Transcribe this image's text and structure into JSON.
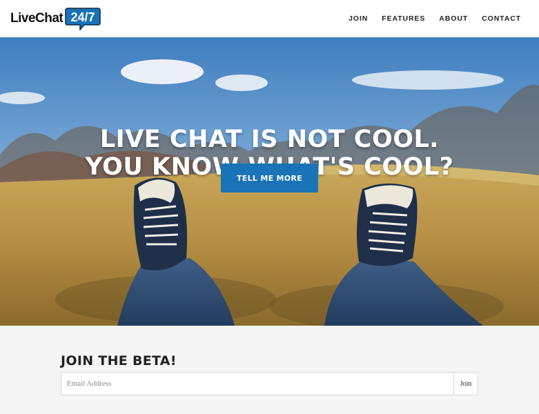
{
  "header": {
    "logo_text": "LiveChat",
    "logo_badge": "24/7",
    "nav": [
      {
        "label": "JOIN"
      },
      {
        "label": "FEATURES"
      },
      {
        "label": "ABOUT"
      },
      {
        "label": "CONTACT"
      }
    ]
  },
  "hero": {
    "line1": "LIVE CHAT IS NOT COOL.",
    "line2": "YOU KNOW WHAT'S COOL?",
    "cta_label": "TELL ME MORE",
    "cta_color": "#1a73b6"
  },
  "beta": {
    "title": "JOIN THE BETA!",
    "email_placeholder": "Email Address",
    "join_label": "Join"
  },
  "colors": {
    "brand_blue": "#1a73b6",
    "text_dark": "#222222"
  }
}
